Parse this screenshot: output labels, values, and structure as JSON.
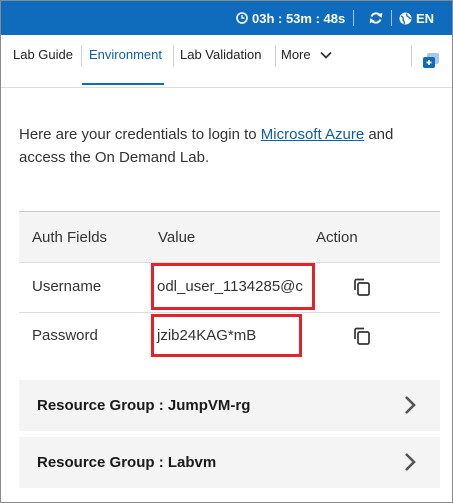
{
  "topbar": {
    "timer": "03h : 53m : 48s",
    "language": "EN",
    "icons": [
      "clock-icon",
      "refresh-icon",
      "globe-icon"
    ]
  },
  "tabs": [
    {
      "label": "Lab Guide",
      "active": false
    },
    {
      "label": "Environment",
      "active": true
    },
    {
      "label": "Lab Validation",
      "active": false
    },
    {
      "label": "More",
      "active": false
    }
  ],
  "intro": {
    "text_before": "Here are your credentials to login to ",
    "link_text": "Microsoft Azure",
    "text_after": " and access the On Demand Lab."
  },
  "table": {
    "headers": [
      "Auth Fields",
      "Value",
      "Action"
    ],
    "rows": [
      {
        "field": "Username",
        "value": "odl_user_1134285@c"
      },
      {
        "field": "Password",
        "value": "jzib24KAG*mB"
      }
    ]
  },
  "resource_groups": [
    {
      "label": "Resource Group : JumpVM-rg"
    },
    {
      "label": "Resource Group : Labvm"
    }
  ],
  "colors": {
    "accent": "#0f6cbd",
    "highlight": "#e0242b"
  }
}
